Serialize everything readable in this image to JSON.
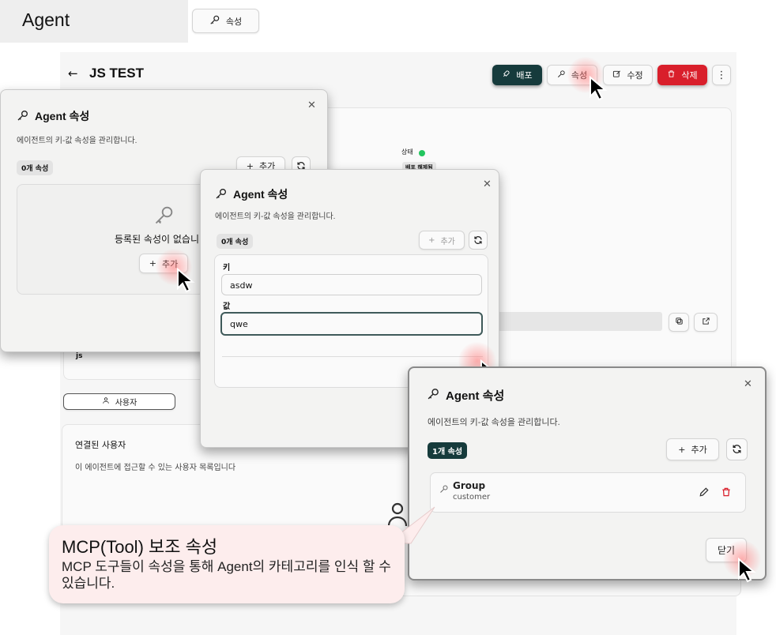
{
  "top": {
    "agent_label": "Agent",
    "attr_button": "속성"
  },
  "page": {
    "title": "JS TEST",
    "buttons": {
      "deploy": "배포",
      "attributes": "속성",
      "edit": "수정",
      "delete": "삭제"
    },
    "status_label": "상태",
    "status_badge": "배포 해제됨",
    "js_label": "js",
    "users_tab": "사용자",
    "linked_users_title": "연결된 사용자",
    "linked_users_desc": "이 에이전트에 접근할 수 있는 사용자 목록입니다"
  },
  "dialog1": {
    "title": "Agent 속성",
    "desc": "에이전트의 키-값 속성을 관리합니다.",
    "count": "0개 속성",
    "add": "추가",
    "empty_text": "등록된 속성이 없습니",
    "empty_add": "추가"
  },
  "dialog2": {
    "title": "Agent 속성",
    "desc": "에이전트의 키-값 속성을 관리합니다.",
    "count": "0개 속성",
    "add": "추가",
    "key_label": "키",
    "key_value": "asdw",
    "value_label": "값",
    "value_value": "qwe"
  },
  "dialog3": {
    "title": "Agent 속성",
    "desc": "에이전트의 키-값 속성을 관리합니다.",
    "count": "1개 속성",
    "add": "추가",
    "item_key": "Group",
    "item_value": "customer",
    "close_label": "닫기"
  },
  "callout": {
    "title": "MCP(Tool) 보조 속성",
    "body": "MCP 도구들이 속성을 통해 Agent의 카테고리를 인식 할 수 있습니다."
  },
  "colors": {
    "deploy": "#163b3c",
    "delete": "#d91f2b",
    "status": "#22c55e",
    "callout_bg": "#fdeded"
  },
  "icons": [
    "key-icon",
    "rocket-icon",
    "edit-icon",
    "trash-icon",
    "refresh-icon",
    "plus-icon",
    "copy-icon",
    "external-link-icon",
    "user-icon",
    "pencil-icon",
    "close-icon",
    "cursor-icon"
  ]
}
